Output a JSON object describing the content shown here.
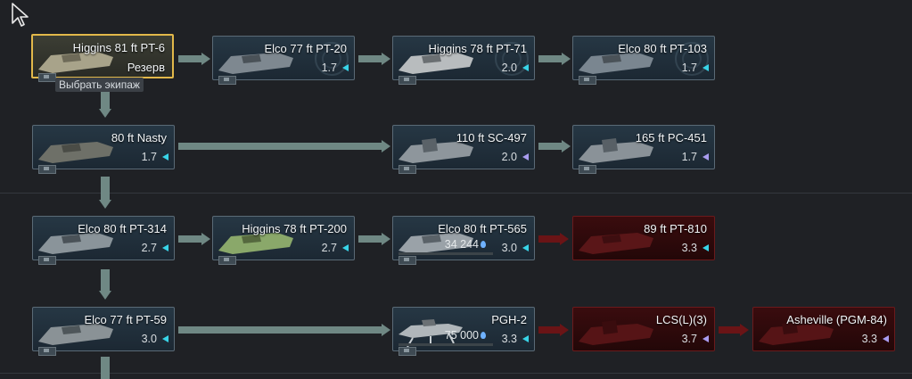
{
  "tree": {
    "row1": [
      {
        "name": "Higgins 81 ft PT-6",
        "status": "Резерв",
        "br": "",
        "tri": "cyan",
        "selected": true
      },
      {
        "name": "Elco 77 ft PT-20",
        "br": "1.7",
        "tri": "cyan"
      },
      {
        "name": "Higgins 78 ft PT-71",
        "br": "2.0",
        "tri": "cyan"
      },
      {
        "name": "Elco 80 ft PT-103",
        "br": "1.7",
        "tri": "cyan"
      }
    ],
    "row2": [
      {
        "name": "80 ft Nasty",
        "br": "1.7",
        "tri": "cyan"
      },
      {
        "name": "110 ft SC-497",
        "br": "2.0",
        "tri": "purple"
      },
      {
        "name": "165 ft PC-451",
        "br": "1.7",
        "tri": "purple"
      }
    ],
    "row3": [
      {
        "name": "Elco 80 ft PT-314",
        "br": "2.7",
        "tri": "cyan"
      },
      {
        "name": "Higgins 78 ft PT-200",
        "br": "2.7",
        "tri": "cyan"
      },
      {
        "name": "Elco 80 ft PT-565",
        "br": "3.0",
        "cost": "34 244",
        "tri": "cyan"
      },
      {
        "name": "89 ft PT-810",
        "br": "3.3",
        "tri": "cyan",
        "locked": true
      }
    ],
    "row4": [
      {
        "name": "Elco 77 ft PT-59",
        "br": "3.0",
        "tri": "cyan"
      },
      {
        "name": "PGH-2",
        "br": "3.3",
        "cost": "75 000",
        "tri": "cyan"
      },
      {
        "name": "LCS(L)(3)",
        "br": "3.7",
        "tri": "purple",
        "locked": true
      },
      {
        "name": "Asheville (PGM-84)",
        "br": "3.3",
        "tri": "purple",
        "locked": true
      }
    ]
  },
  "tooltip": {
    "label": "Выбрать экипаж"
  },
  "colors": {
    "accent_cyan": "#38d4e8",
    "accent_purple": "#a99cf0",
    "locked_red": "#6b1a1c",
    "selected_gold": "#e2b84a"
  }
}
